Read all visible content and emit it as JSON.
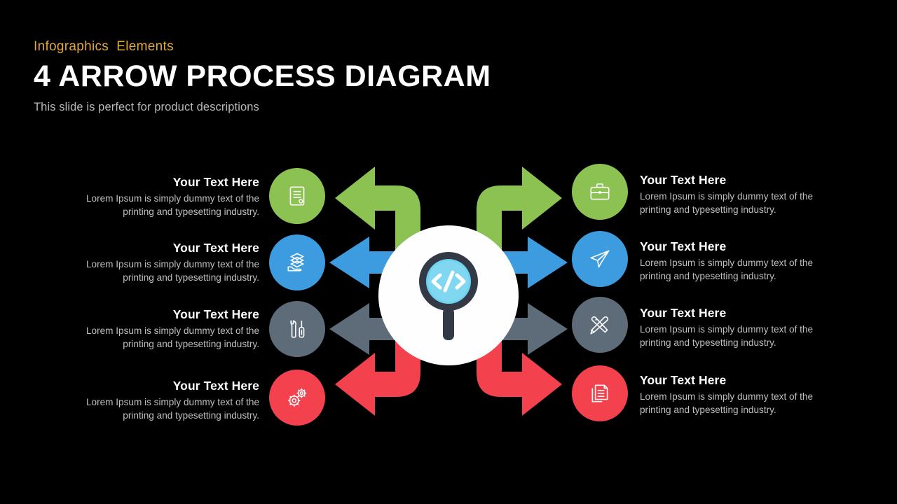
{
  "header": {
    "eyebrow": "Infographics  Elements",
    "title": "4 ARROW PROCESS DIAGRAM",
    "subtitle": "This slide is perfect for product descriptions"
  },
  "colors": {
    "background": "#000000",
    "eyebrow": "#E0A83A",
    "title": "#FFFFFF",
    "subtitle": "#B9B9B9",
    "green": "#8CC252",
    "blue": "#3D9BE0",
    "gray": "#5E6B78",
    "red": "#F3414E",
    "hub": "#FEFEFE",
    "lens_glass": "#6FD2EE",
    "lens_ring": "#333A45"
  },
  "center": {
    "icon": "magnifier-code-icon",
    "glyph": "</>"
  },
  "rows": [
    {
      "color": "#8CC252",
      "arrow_shape": "elbow-up",
      "left": {
        "icon": "certificate-document-icon",
        "heading": "Your Text Here",
        "body": "Lorem Ipsum  is simply dummy  text of the printing  and typesetting industry."
      },
      "right": {
        "icon": "briefcase-icon",
        "heading": "Your Text Here",
        "body": "Lorem Ipsum  is simply dummy  text of the printing  and typesetting industry."
      }
    },
    {
      "color": "#3D9BE0",
      "arrow_shape": "straight",
      "left": {
        "icon": "hand-holding-layers-icon",
        "heading": "Your Text Here",
        "body": "Lorem Ipsum  is simply dummy  text of the printing  and typesetting industry."
      },
      "right": {
        "icon": "paper-plane-icon",
        "heading": "Your Text Here",
        "body": "Lorem Ipsum  is simply dummy  text of the printing  and typesetting industry."
      }
    },
    {
      "color": "#5E6B78",
      "arrow_shape": "straight",
      "left": {
        "icon": "wrench-screwdriver-icon",
        "heading": "Your Text Here",
        "body": "Lorem Ipsum  is simply dummy  text of the printing  and typesetting industry."
      },
      "right": {
        "icon": "pencil-ruler-icon",
        "heading": "Your Text Here",
        "body": "Lorem Ipsum  is simply dummy  text of the printing  and typesetting industry."
      }
    },
    {
      "color": "#F3414E",
      "arrow_shape": "elbow-down",
      "left": {
        "icon": "gears-icon",
        "heading": "Your Text Here",
        "body": "Lorem Ipsum  is simply dummy  text of the printing  and typesetting industry."
      },
      "right": {
        "icon": "documents-copy-icon",
        "heading": "Your Text Here",
        "body": "Lorem Ipsum  is simply dummy  text of the printing  and typesetting industry."
      }
    }
  ]
}
